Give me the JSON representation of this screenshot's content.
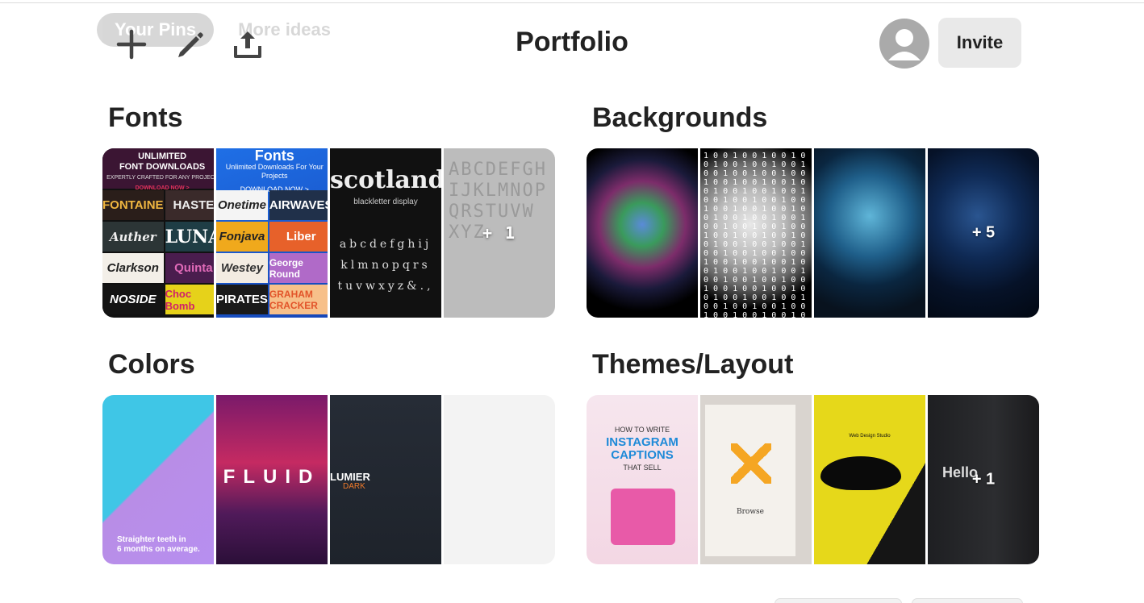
{
  "background_tabs": [
    "Your Pins",
    "More ideas"
  ],
  "toolbar": {
    "add_icon": "plus-icon",
    "edit_icon": "pencil-icon",
    "share_icon": "upload-icon"
  },
  "title": "Portfolio",
  "invite_label": "Invite",
  "boards": [
    {
      "name": "Fonts",
      "overflow_count": "+ 1"
    },
    {
      "name": "Backgrounds",
      "overflow_count": "+ 5"
    },
    {
      "name": "Colors",
      "overflow_count": ""
    },
    {
      "name": "Themes/Layout",
      "overflow_count": "+ 1"
    }
  ],
  "fonts_pins": {
    "banner": [
      "UNLIMITED",
      "FONT DOWNLOADS",
      "EXPERTLY CRAFTED FOR ANY PROJECT",
      "DOWNLOAD NOW >"
    ],
    "samples": [
      "FONTAINE",
      "HASTE",
      "Auther",
      "LUNA",
      "Clarkson",
      "Quinta",
      "NOSIDE",
      "Choc Bomb"
    ],
    "ad": [
      "Fonts",
      "Unlimited Downloads For Your Projects",
      "DOWNLOAD NOW >"
    ],
    "ad_samples": [
      "Onetime",
      "AIRWAVES",
      "Fonjava",
      "Liber",
      "Westey",
      "George Round",
      "PIRATES",
      "GRAHAM CRACKER"
    ],
    "scotland": [
      "scotland",
      "blackletter display",
      "abcdefghij",
      "klmnopqrs",
      "tuvwxyz&.,"
    ],
    "outline": "ABCDEFGH IJKLMNOP QRSTUVW XYZ"
  },
  "colors_pins": {
    "teeth_caption": [
      "Straighter teeth in",
      "6 months on average."
    ],
    "fluid_word": "FLUID",
    "lumier": [
      "LUMIER",
      "DARK"
    ]
  },
  "themes_pins": {
    "insta": [
      "HOW TO WRITE",
      "INSTAGRAM",
      "CAPTIONS",
      "THAT SELL"
    ],
    "browse": "Browse",
    "banana_header": "Web Design Studio",
    "hello": "Hello"
  }
}
